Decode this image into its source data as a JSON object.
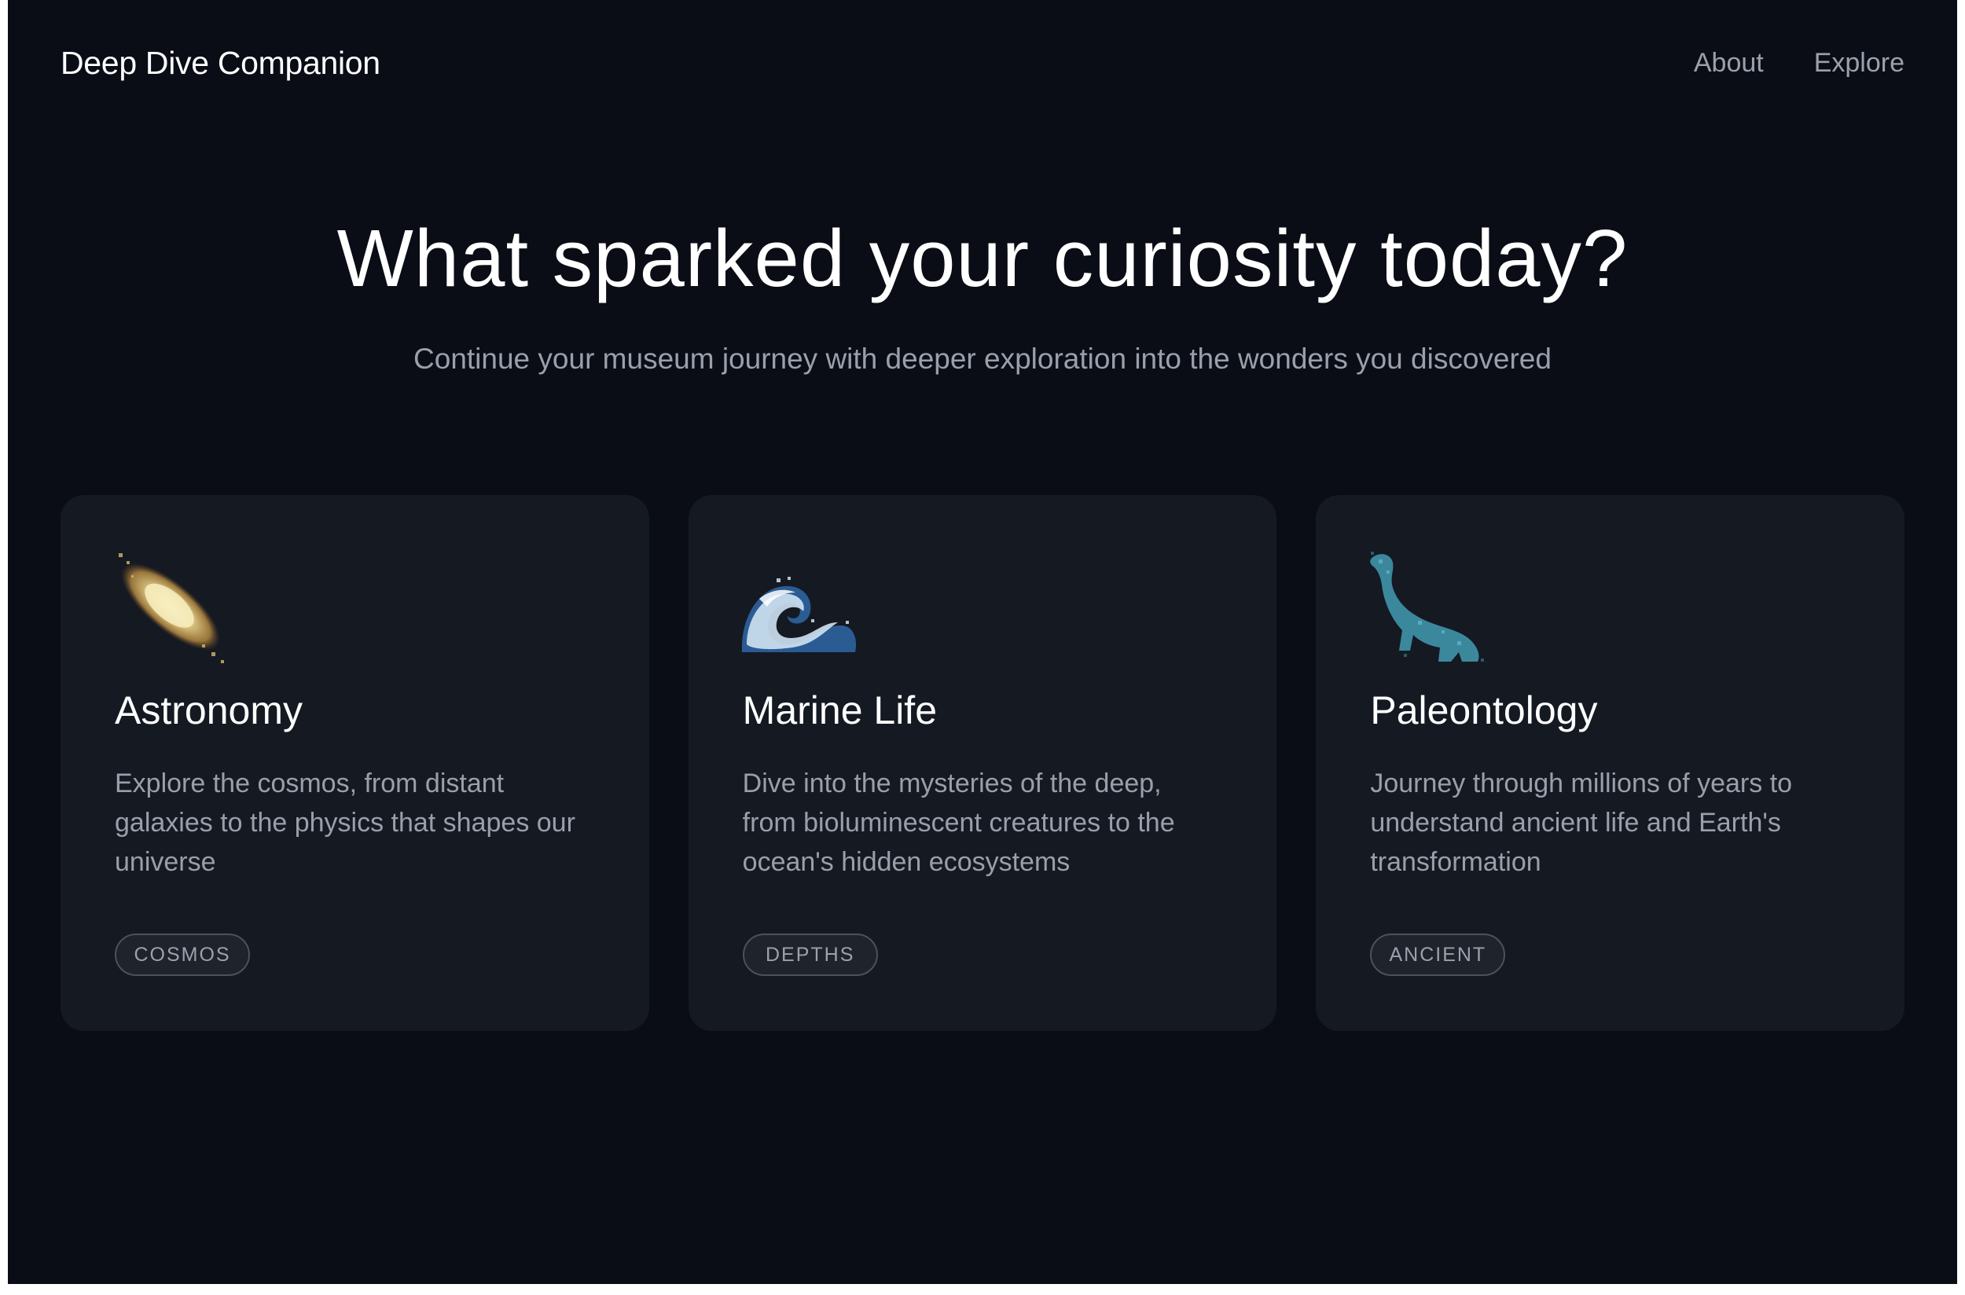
{
  "header": {
    "brand": "Deep Dive Companion",
    "nav": [
      {
        "label": "About"
      },
      {
        "label": "Explore"
      }
    ]
  },
  "hero": {
    "title": "What sparked your curiosity today?",
    "subtitle": "Continue your museum journey with deeper exploration into the wonders you discovered"
  },
  "cards": [
    {
      "title": "Astronomy",
      "description": "Explore the cosmos, from distant galaxies to the physics that shapes our universe",
      "tag": "COSMOS",
      "icon": "galaxy-icon",
      "accent": "#e8d9a0"
    },
    {
      "title": "Marine Life",
      "description": "Dive into the mysteries of the deep, from bioluminescent creatures to the ocean's hidden ecosystems",
      "tag": "DEPTHS",
      "icon": "wave-icon",
      "accent": "#8fb8d8"
    },
    {
      "title": "Paleontology",
      "description": "Journey through millions of years to understand ancient life and Earth's transformation",
      "tag": "ANCIENT",
      "icon": "dinosaur-icon",
      "accent": "#4a9ab0"
    }
  ],
  "colors": {
    "background": "#0a0d16",
    "card": "#151922",
    "muted_text": "#99a0ab",
    "tag_border": "#4b515d"
  }
}
